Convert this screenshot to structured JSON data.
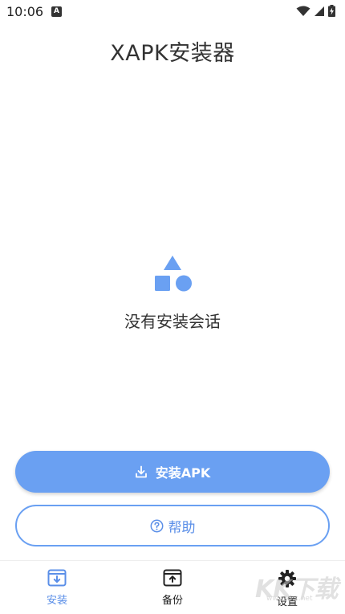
{
  "status_bar": {
    "time": "10:06",
    "notification_letter": "A",
    "icons": [
      "wifi-icon",
      "signal-icon",
      "battery-charging-icon"
    ]
  },
  "app": {
    "title": "XAPK安装器"
  },
  "empty_state": {
    "icon": "shapes-icon",
    "text": "没有安装会话"
  },
  "actions": {
    "install_label": "安装APK",
    "help_label": "帮助"
  },
  "nav": {
    "items": [
      {
        "label": "安装",
        "icon": "install-box-icon",
        "active": true
      },
      {
        "label": "备份",
        "icon": "backup-box-icon",
        "active": false
      },
      {
        "label": "设置",
        "icon": "gear-icon",
        "active": false
      }
    ]
  },
  "watermark": {
    "title": "KK下载",
    "url": "www.kkx.net"
  },
  "colors": {
    "accent": "#6aa0f2",
    "accent_text": "#5b8fe8",
    "text": "#333333",
    "background": "#ffffff"
  }
}
